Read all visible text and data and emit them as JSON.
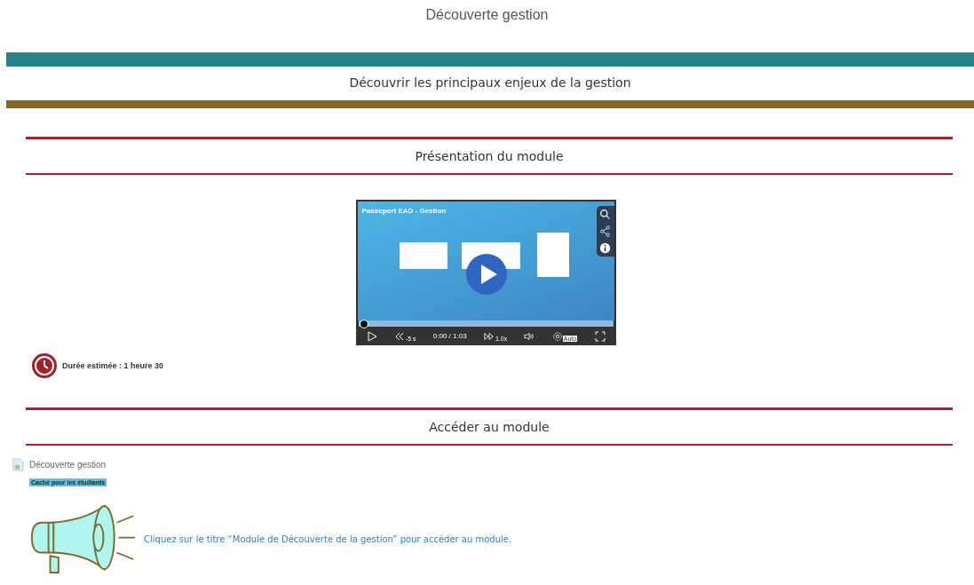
{
  "page_title": "Découverte gestion",
  "banner": {
    "title": "Découvrir les principaux enjeux de la gestion"
  },
  "sections": [
    {
      "title": "Présentation du module"
    },
    {
      "title": "Accéder au module"
    }
  ],
  "video": {
    "title": "Passeport EAD - Gestion",
    "time": "0:00 / 1:03",
    "rewind_label": "-5 s",
    "speed": "1.0x",
    "quality": "Auto",
    "level": 0.0
  },
  "duration": "Durée estimée : 1 heure 30",
  "resource": {
    "name": "Découverte gestion",
    "badge": "Caché pour les étudiants"
  },
  "notice": "Cliquez sur le titre “Module de Découverte de la gestion” pour accéder au module."
}
